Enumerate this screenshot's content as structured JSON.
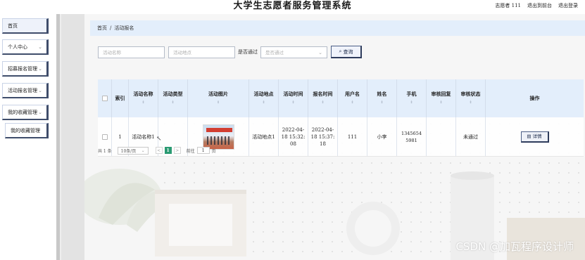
{
  "header": {
    "title": "大学生志愿者服务管理系统",
    "user": "志愿者 111",
    "exit_front": "退出到前台",
    "logout": "退出登录"
  },
  "sidebar": {
    "items": [
      {
        "label": "首页",
        "has_chevron": false
      },
      {
        "label": "个人中心",
        "has_chevron": true
      },
      {
        "label": "招募报名管理",
        "has_chevron": true
      },
      {
        "label": "活动报名管理",
        "has_chevron": true
      },
      {
        "label": "我的收藏管理",
        "has_chevron": true
      },
      {
        "label": "我的收藏管理",
        "has_chevron": false
      }
    ]
  },
  "breadcrumb": {
    "home": "首页",
    "separator": "/",
    "current": "活动报名"
  },
  "search": {
    "name_placeholder": "活动名称",
    "location_placeholder": "活动地点",
    "pass_label": "是否通过",
    "pass_placeholder": "是否通过",
    "query_label": "查询",
    "query_icon": "search-icon"
  },
  "table": {
    "columns": [
      {
        "key": "index",
        "label": "索引",
        "sortable": false
      },
      {
        "key": "name",
        "label": "活动名称",
        "sortable": true
      },
      {
        "key": "type",
        "label": "活动类型",
        "sortable": true
      },
      {
        "key": "image",
        "label": "活动图片",
        "sortable": true
      },
      {
        "key": "location",
        "label": "活动地点",
        "sortable": true
      },
      {
        "key": "time",
        "label": "活动时间",
        "sortable": true
      },
      {
        "key": "signup_time",
        "label": "报名时间",
        "sortable": true
      },
      {
        "key": "username",
        "label": "用户名",
        "sortable": true
      },
      {
        "key": "realname",
        "label": "姓名",
        "sortable": true
      },
      {
        "key": "phone",
        "label": "手机",
        "sortable": true
      },
      {
        "key": "reply",
        "label": "审核回复",
        "sortable": true
      },
      {
        "key": "status",
        "label": "审核状态",
        "sortable": true
      },
      {
        "key": "action",
        "label": "操作",
        "sortable": false
      }
    ],
    "rows": [
      {
        "index": "1",
        "name": "活动名称1",
        "type": "",
        "location": "活动地点1",
        "time": "2022-04-18 15:32:08",
        "signup_time": "2022-04-18 15:37:18",
        "username": "111",
        "realname": "小李",
        "phone": "13456545981",
        "reply": "",
        "status": "未通过",
        "action_label": "详情"
      }
    ]
  },
  "pagination": {
    "total_text": "共 1 条",
    "page_size": "10条/页",
    "prev": "<",
    "current_page": "1",
    "next": ">",
    "goto_label": "前往",
    "goto_value": "1",
    "page_suffix": "页"
  },
  "watermark": "CSDN @加瓦程序设计师",
  "colors": {
    "breadcrumb_bg": "#e3eefb",
    "button_border": "#2e3c5c",
    "page_active": "#2a9a72"
  }
}
